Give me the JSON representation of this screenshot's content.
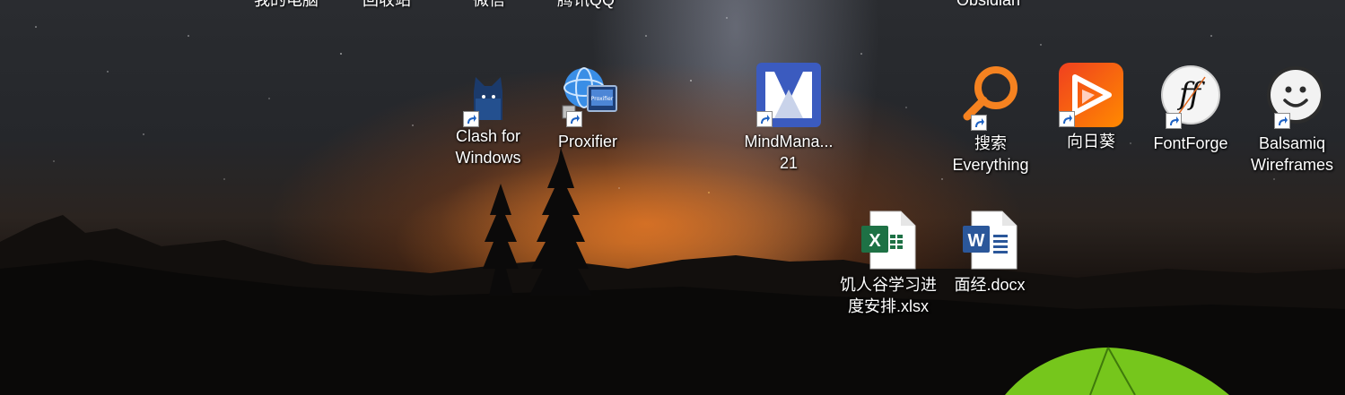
{
  "desktop": {
    "top_row": [
      {
        "label": "我的电脑"
      },
      {
        "label": "回收站"
      },
      {
        "label": "微信"
      },
      {
        "label": "腾讯QQ"
      },
      {
        "label": "Obsidian"
      }
    ],
    "icons": [
      {
        "id": "clash",
        "label": "Clash for\nWindows"
      },
      {
        "id": "proxifier",
        "label": "Proxifier",
        "badge": "Proxifier"
      },
      {
        "id": "mindmanager",
        "label": "MindMana...\n21"
      },
      {
        "id": "everything",
        "label": "搜索\nEverything"
      },
      {
        "id": "sunflower",
        "label": "向日葵"
      },
      {
        "id": "fontforge",
        "label": "FontForge",
        "glyph": "ff"
      },
      {
        "id": "balsamiq",
        "label": "Balsamiq\nWireframes"
      },
      {
        "id": "xlsx",
        "label": "饥人谷学习进\n度安排.xlsx",
        "glyph": "X"
      },
      {
        "id": "docx",
        "label": "面经.docx",
        "glyph": "W"
      }
    ],
    "colors": {
      "excel": "#1e7145",
      "word": "#2b579a",
      "mindmanager": "#3b5bbf",
      "everything": "#f58220",
      "sunflower": "#f04e23",
      "tent": "#7cd11e"
    }
  }
}
